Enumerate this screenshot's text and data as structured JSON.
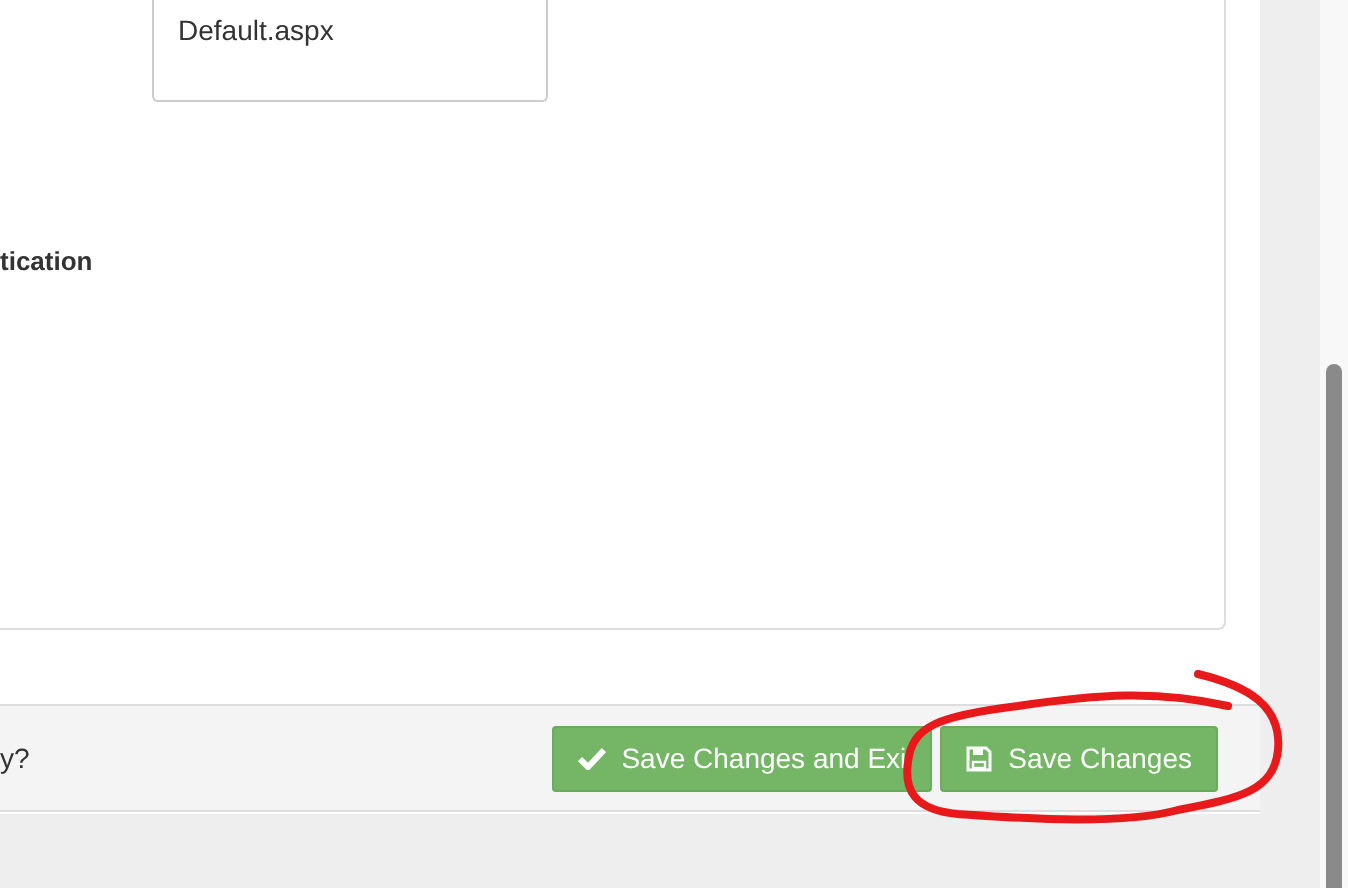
{
  "listbox": {
    "items": [
      "Default.aspx"
    ]
  },
  "section_label": "tication",
  "footer": {
    "question": "y?",
    "buttons": [
      {
        "label": "Save Changes and Exi",
        "kind": "check",
        "circled": false
      },
      {
        "label": "Save Changes",
        "kind": "save",
        "circled": true
      }
    ]
  }
}
